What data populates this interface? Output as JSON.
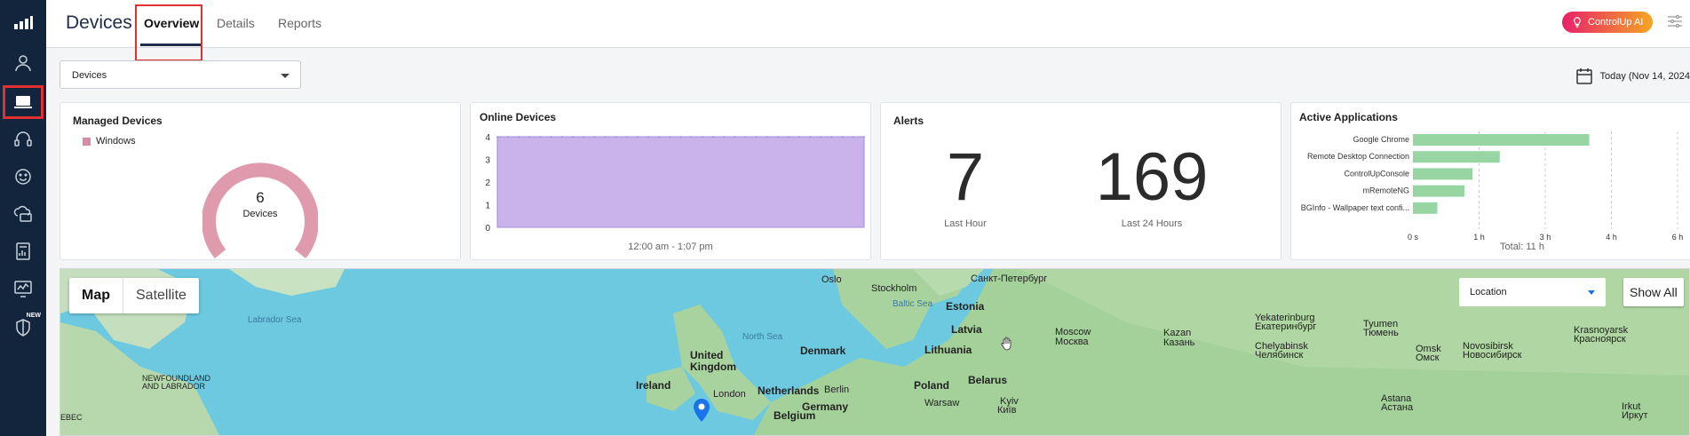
{
  "header": {
    "title": "Devices",
    "tabs": [
      {
        "label": "Overview",
        "active": true
      },
      {
        "label": "Details",
        "active": false
      },
      {
        "label": "Reports",
        "active": false
      }
    ],
    "ai_button": "ControlUp AI"
  },
  "sidebar": {
    "items": [
      {
        "icon": "user-icon"
      },
      {
        "icon": "laptop-icon",
        "active": true
      },
      {
        "icon": "headset-icon"
      },
      {
        "icon": "smiley-icon"
      },
      {
        "icon": "cloud-folder-icon"
      },
      {
        "icon": "report-icon"
      },
      {
        "icon": "monitor-chart-icon"
      },
      {
        "icon": "shield-icon",
        "badge": "NEW"
      }
    ]
  },
  "filter": {
    "value": "Devices"
  },
  "date": {
    "label": "Today (Nov 14, 2024"
  },
  "managed_devices": {
    "title": "Managed Devices",
    "legend": "Windows",
    "count": "6",
    "unit": "Devices",
    "color": "#e09aae"
  },
  "online_devices": {
    "title": "Online Devices",
    "range": "12:00 am - 1:07 pm",
    "color": "#c9b3ea",
    "chart_data": {
      "type": "area",
      "yticks": [
        "0",
        "1",
        "2",
        "3",
        "4"
      ],
      "ylim": [
        0,
        4
      ],
      "values": [
        4,
        4,
        4,
        4,
        4,
        4,
        4,
        4,
        4,
        4,
        4,
        4,
        4,
        4,
        4,
        4,
        4,
        4,
        4,
        4,
        4,
        4,
        4,
        4,
        4,
        4,
        4,
        4,
        4,
        4,
        4,
        4,
        4,
        4,
        4
      ],
      "xlabel": "12:00 am - 1:07 pm"
    }
  },
  "alerts": {
    "title": "Alerts",
    "last_hour": "7",
    "last_hour_label": "Last Hour",
    "last_24": "169",
    "last_24_label": "Last 24 Hours"
  },
  "active_apps": {
    "title": "Active Applications",
    "total": "Total: 11 h",
    "color": "#97d6a3",
    "chart_data": {
      "type": "bar",
      "orientation": "horizontal",
      "categories": [
        "Google Chrome",
        "Remote Desktop Connection",
        "ControlUpConsole",
        "mRemoteNG",
        "BGInfo - Wallpaper text confi..."
      ],
      "values": [
        3.25,
        1.6,
        1.1,
        0.95,
        0.45
      ],
      "xticks": [
        "0 s",
        "1 h",
        "3 h",
        "4 h",
        "6 h"
      ],
      "xlim": [
        0,
        4
      ]
    }
  },
  "map": {
    "buttons": [
      "Map",
      "Satellite"
    ],
    "location_placeholder": "Location",
    "show_all": "Show All",
    "labels": [
      {
        "text": "Labrador Sea",
        "cls": "sea"
      },
      {
        "text": "NEWFOUNDLAND",
        "cls": "small"
      },
      {
        "text": "AND LABRADOR",
        "cls": "small"
      },
      {
        "text": "EBEC",
        "cls": "small"
      },
      {
        "text": "North Sea",
        "cls": "sea"
      },
      {
        "text": "Baltic Sea",
        "cls": "sea"
      },
      {
        "text": "United",
        "cls": "big"
      },
      {
        "text": "Kingdom",
        "cls": "big"
      },
      {
        "text": "Ireland",
        "cls": "big"
      },
      {
        "text": "London",
        "cls": ""
      },
      {
        "text": "Netherlands",
        "cls": "big"
      },
      {
        "text": "Berlin",
        "cls": ""
      },
      {
        "text": "Germany",
        "cls": "big"
      },
      {
        "text": "Belgium",
        "cls": "big"
      },
      {
        "text": "Denmark",
        "cls": "big"
      },
      {
        "text": "Oslo",
        "cls": ""
      },
      {
        "text": "Stockholm",
        "cls": ""
      },
      {
        "text": "Estonia",
        "cls": "big"
      },
      {
        "text": "Latvia",
        "cls": "big"
      },
      {
        "text": "Lithuania",
        "cls": "big"
      },
      {
        "text": "Belarus",
        "cls": "big"
      },
      {
        "text": "Poland",
        "cls": "big"
      },
      {
        "text": "Warsaw",
        "cls": ""
      },
      {
        "text": "Kyiv",
        "cls": ""
      },
      {
        "text": "Київ",
        "cls": ""
      },
      {
        "text": "Санкт-Петербург",
        "cls": ""
      },
      {
        "text": "Moscow",
        "cls": ""
      },
      {
        "text": "Москва",
        "cls": ""
      },
      {
        "text": "Kazan",
        "cls": ""
      },
      {
        "text": "Казань",
        "cls": ""
      },
      {
        "text": "Yekaterinburg",
        "cls": ""
      },
      {
        "text": "Екатеринбург",
        "cls": ""
      },
      {
        "text": "Chelyabinsk",
        "cls": ""
      },
      {
        "text": "Челябинск",
        "cls": ""
      },
      {
        "text": "Tyumen",
        "cls": ""
      },
      {
        "text": "Тюмень",
        "cls": ""
      },
      {
        "text": "Omsk",
        "cls": ""
      },
      {
        "text": "Омск",
        "cls": ""
      },
      {
        "text": "Novosibirsk",
        "cls": ""
      },
      {
        "text": "Новосибирск",
        "cls": ""
      },
      {
        "text": "Krasnoyarsk",
        "cls": ""
      },
      {
        "text": "Красноярск",
        "cls": ""
      },
      {
        "text": "Astana",
        "cls": ""
      },
      {
        "text": "Астана",
        "cls": ""
      },
      {
        "text": "Irkut",
        "cls": ""
      },
      {
        "text": "Иркут",
        "cls": ""
      }
    ]
  }
}
